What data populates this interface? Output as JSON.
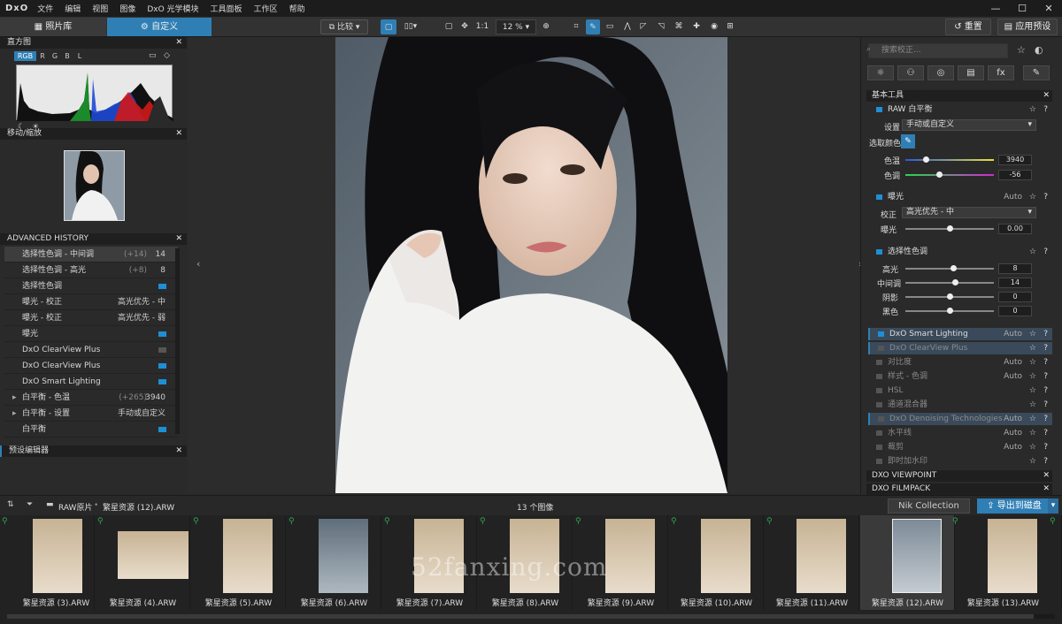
{
  "menu": {
    "logo": "DxO",
    "items": [
      "文件",
      "编辑",
      "视图",
      "图像",
      "DxO 光学模块",
      "工具面板",
      "工作区",
      "帮助"
    ]
  },
  "window": {
    "minimize": "—",
    "maximize": "☐",
    "close": "✕"
  },
  "toolbar": {
    "tab_library": "照片库",
    "tab_customize": "自定义",
    "compare": "比较",
    "fit": "1:1",
    "zoom": "12 %",
    "reset": "重置",
    "apply_preset": "应用预设"
  },
  "left": {
    "histogram_title": "直方图",
    "histogram_tabs": [
      "RGB",
      "R",
      "G",
      "B",
      "L"
    ],
    "nav_title": "移动/缩放",
    "history_title": "ADVANCED HISTORY",
    "history": [
      {
        "label": "选择性色调 - 中间调",
        "delta": "(+14)",
        "value": "14",
        "sel": true
      },
      {
        "label": "选择性色调 - 高光",
        "delta": "(+8)",
        "value": "8"
      },
      {
        "label": "选择性色调",
        "toggle": "on"
      },
      {
        "label": "曝光 - 校正",
        "value": "高光优先 - 中"
      },
      {
        "label": "曝光 - 校正",
        "value": "高光优先 - 弱"
      },
      {
        "label": "曝光",
        "toggle": "on"
      },
      {
        "label": "DxO ClearView Plus",
        "toggle": "off"
      },
      {
        "label": "DxO ClearView Plus",
        "toggle": "on"
      },
      {
        "label": "DxO Smart Lighting",
        "toggle": "on"
      },
      {
        "label": "白平衡 - 色温",
        "delta": "(+265)",
        "value": "3940",
        "arrow": "▸"
      },
      {
        "label": "白平衡 - 设置",
        "value": "手动或自定义",
        "arrow": "▸"
      },
      {
        "label": "白平衡",
        "toggle": "on"
      }
    ],
    "preset_editor": "预设编辑器"
  },
  "right": {
    "search_placeholder": "搜索校正...",
    "tab_icons": [
      "sun-icon",
      "color-icon",
      "detail-icon",
      "geometry-icon",
      "fx-icon",
      "local-icon"
    ],
    "tab_glyphs": [
      "☼",
      "⚇",
      "◎",
      "▤",
      "fx",
      "✎"
    ],
    "basic_tools": "基本工具",
    "raw_wb": "RAW 白平衡",
    "setting_label": "设置",
    "setting_value": "手动或自定义",
    "pick_color": "选取颜色",
    "temp_label": "色温",
    "temp_value": "3940",
    "tint_label": "色调",
    "tint_value": "-56",
    "exposure": "曝光",
    "auto": "Auto",
    "correct_label": "校正",
    "correct_value": "高光优先 - 中",
    "exp_label": "曝光",
    "exp_value": "0.00",
    "sel_tone": "选择性色调",
    "tones": [
      {
        "label": "高光",
        "value": "8"
      },
      {
        "label": "中间调",
        "value": "14"
      },
      {
        "label": "阴影",
        "value": "0"
      },
      {
        "label": "黑色",
        "value": "0"
      }
    ],
    "tools": [
      {
        "label": "DxO Smart Lighting",
        "auto": "Auto",
        "hl": true,
        "on": true
      },
      {
        "label": "DxO ClearView Plus",
        "auto": "",
        "hl": true,
        "on": false
      },
      {
        "label": "对比度",
        "auto": "Auto"
      },
      {
        "label": "样式 - 色调",
        "auto": "Auto"
      },
      {
        "label": "HSL",
        "auto": ""
      },
      {
        "label": "通道混合器",
        "auto": ""
      },
      {
        "label": "DxO Denoising Technologies",
        "auto": "Auto",
        "hl": true
      },
      {
        "label": "水平线",
        "auto": "Auto"
      },
      {
        "label": "裁剪",
        "auto": "Auto"
      },
      {
        "label": "即时加水印",
        "auto": ""
      }
    ],
    "viewpoint": "DXO VIEWPOINT",
    "filmpack": "DXO FILMPACK"
  },
  "strip": {
    "path1": "RAW原片",
    "path2": "繁星资源 (12).ARW",
    "count": "13 个图像",
    "nik": "Nik Collection",
    "export": "导出到磁盘",
    "watermark": "52fanxing.com",
    "files": [
      "繁星资源 (3).ARW",
      "繁星资源 (4).ARW",
      "繁星资源 (5).ARW",
      "繁星资源 (6).ARW",
      "繁星资源 (7).ARW",
      "繁星资源 (8).ARW",
      "繁星资源 (9).ARW",
      "繁星资源 (10).ARW",
      "繁星资源 (11).ARW",
      "繁星资源 (12).ARW",
      "繁星资源 (13).ARW"
    ]
  },
  "colors": {
    "accent": "#2f7fb5",
    "toggle": "#1e8fd6"
  }
}
